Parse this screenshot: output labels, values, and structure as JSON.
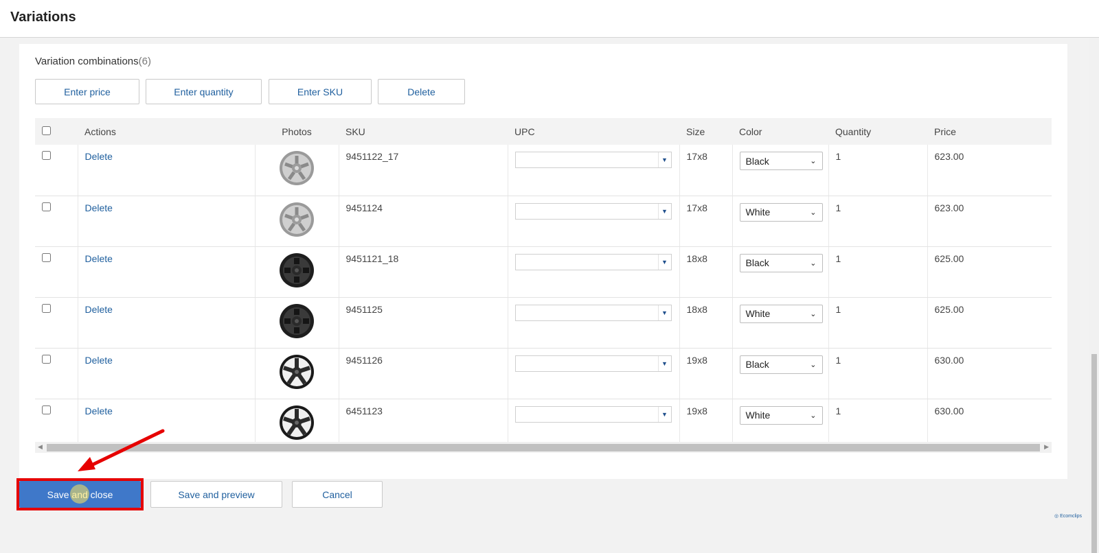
{
  "header": {
    "title": "Variations"
  },
  "section": {
    "title": "Variation combinations",
    "count": "(6)"
  },
  "bulk_actions": [
    "Enter price",
    "Enter quantity",
    "Enter SKU",
    "Delete"
  ],
  "table": {
    "columns": [
      "Actions",
      "Photos",
      "SKU",
      "UPC",
      "Size",
      "Color",
      "Quantity",
      "Price"
    ],
    "rows": [
      {
        "action": "Delete",
        "photo": "silver-wheel-icon",
        "sku": "9451122_17",
        "upc": "",
        "size": "17x8",
        "color": "Black",
        "quantity": "1",
        "price": "623.00"
      },
      {
        "action": "Delete",
        "photo": "silver-wheel-icon",
        "sku": "9451124",
        "upc": "",
        "size": "17x8",
        "color": "White",
        "quantity": "1",
        "price": "623.00"
      },
      {
        "action": "Delete",
        "photo": "black-offroad-wheel-icon",
        "sku": "9451121_18",
        "upc": "",
        "size": "18x8",
        "color": "Black",
        "quantity": "1",
        "price": "625.00"
      },
      {
        "action": "Delete",
        "photo": "black-offroad-wheel-icon",
        "sku": "9451125",
        "upc": "",
        "size": "18x8",
        "color": "White",
        "quantity": "1",
        "price": "625.00"
      },
      {
        "action": "Delete",
        "photo": "black-spoke-wheel-icon",
        "sku": "9451126",
        "upc": "",
        "size": "19x8",
        "color": "Black",
        "quantity": "1",
        "price": "630.00"
      },
      {
        "action": "Delete",
        "photo": "black-spoke-wheel-icon",
        "sku": "6451123",
        "upc": "",
        "size": "19x8",
        "color": "White",
        "quantity": "1",
        "price": "630.00"
      }
    ]
  },
  "footer": {
    "save_close": "Save and close",
    "save_preview": "Save and preview",
    "cancel": "Cancel"
  },
  "watermark": "Ecomclips",
  "colors": {
    "link": "#1f5f9e",
    "primary": "#3f78c9",
    "highlight": "#e60000"
  }
}
